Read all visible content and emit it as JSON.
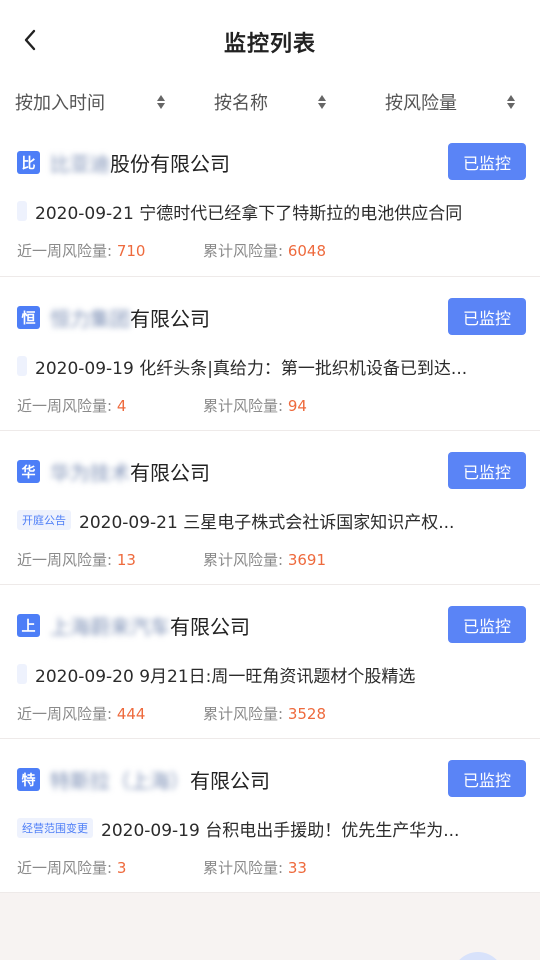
{
  "header": {
    "title": "监控列表",
    "back_icon": "chevron-left-icon"
  },
  "sort": [
    {
      "label": "按加入时间"
    },
    {
      "label": "按名称"
    },
    {
      "label": "按风险量"
    }
  ],
  "colors": {
    "accent": "#5a84f6",
    "badge": "#4d7ef7",
    "value": "#ee6a3d"
  },
  "list": [
    {
      "badge": "比",
      "name_blur": "比亚迪",
      "name_suffix": "股份有限公司",
      "button": "已监控",
      "tag": "",
      "news": "2020-09-21 宁德时代已经拿下了特斯拉的电池供应合同",
      "week_label": "近一周风险量:",
      "week_value": "710",
      "cum_label": "累计风险量:",
      "cum_value": "6048"
    },
    {
      "badge": "恒",
      "name_blur": "恒力集团",
      "name_suffix": "有限公司",
      "button": "已监控",
      "tag": "",
      "news": "2020-09-19 化纤头条|真给力：第一批织机设备已到达...",
      "week_label": "近一周风险量:",
      "week_value": "4",
      "cum_label": "累计风险量:",
      "cum_value": "94"
    },
    {
      "badge": "华",
      "name_blur": "华为技术",
      "name_suffix": "有限公司",
      "button": "已监控",
      "tag": "开庭公告",
      "news": "2020-09-21 三星电子株式会社诉国家知识产权...",
      "week_label": "近一周风险量:",
      "week_value": "13",
      "cum_label": "累计风险量:",
      "cum_value": "3691"
    },
    {
      "badge": "上",
      "name_blur": "上海蔚来汽车",
      "name_suffix": "有限公司",
      "button": "已监控",
      "tag": "",
      "news": "2020-09-20 9月21日:周一旺角资讯题材个股精选",
      "week_label": "近一周风险量:",
      "week_value": "444",
      "cum_label": "累计风险量:",
      "cum_value": "3528"
    },
    {
      "badge": "特",
      "name_blur": "特斯拉（上海）",
      "name_suffix": "有限公司",
      "button": "已监控",
      "tag": "经营范围变更",
      "news": "2020-09-19 台积电出手援助！优先生产华为...",
      "week_label": "近一周风险量:",
      "week_value": "3",
      "cum_label": "累计风险量:",
      "cum_value": "33"
    }
  ]
}
